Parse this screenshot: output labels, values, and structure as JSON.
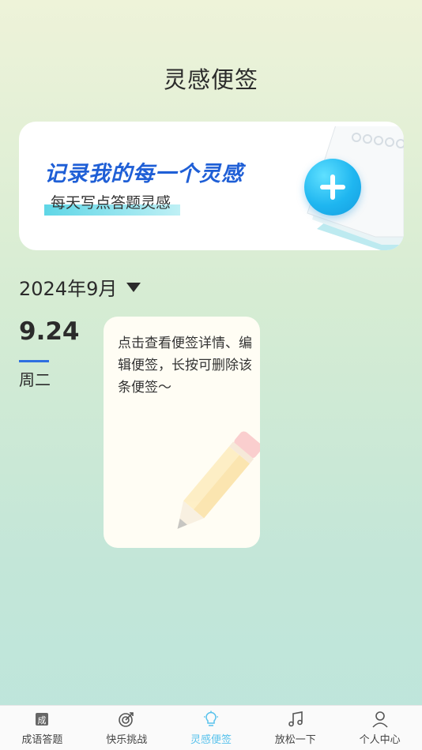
{
  "header": {
    "title": "灵感便签"
  },
  "banner": {
    "headline": "记录我的每一个灵感",
    "subtitle": "每天写点答题灵感"
  },
  "month_selector": {
    "label": "2024年9月"
  },
  "entries": [
    {
      "date": "9.24",
      "weekday": "周二",
      "note": "点击查看便签详情、编辑便签，长按可删除该条便签～"
    }
  ],
  "tabbar": {
    "tabs": [
      {
        "label": "成语答题",
        "icon": "idiom-icon"
      },
      {
        "label": "快乐挑战",
        "icon": "target-icon"
      },
      {
        "label": "灵感便签",
        "icon": "lightbulb-icon",
        "active": true
      },
      {
        "label": "放松一下",
        "icon": "music-note-icon"
      },
      {
        "label": "个人中心",
        "icon": "person-icon"
      }
    ],
    "active_color": "#58c2ec"
  },
  "colors": {
    "accent_blue": "#1f5fd6",
    "add_button": "#1fb6f0"
  }
}
